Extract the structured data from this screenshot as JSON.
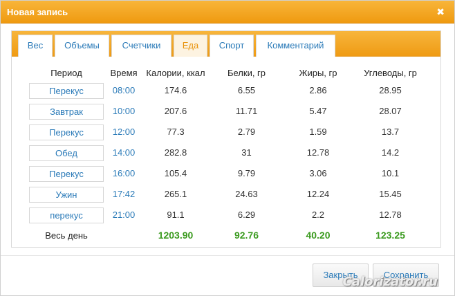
{
  "dialog": {
    "title": "Новая запись",
    "close_glyph": "✖"
  },
  "tabs": [
    {
      "label": "Вес",
      "active": false
    },
    {
      "label": "Объемы",
      "active": false
    },
    {
      "label": "Счетчики",
      "active": false
    },
    {
      "label": "Еда",
      "active": true
    },
    {
      "label": "Спорт",
      "active": false
    },
    {
      "label": "Комментарий",
      "active": false
    }
  ],
  "table": {
    "headers": [
      "Период",
      "Время",
      "Калории, ккал",
      "Белки, гр",
      "Жиры, гр",
      "Углеводы, гр"
    ],
    "rows": [
      {
        "period": "Перекус",
        "time": "08:00",
        "calories": "174.6",
        "protein": "6.55",
        "fat": "2.86",
        "carbs": "28.95"
      },
      {
        "period": "Завтрак",
        "time": "10:00",
        "calories": "207.6",
        "protein": "11.71",
        "fat": "5.47",
        "carbs": "28.07"
      },
      {
        "period": "Перекус",
        "time": "12:00",
        "calories": "77.3",
        "protein": "2.79",
        "fat": "1.59",
        "carbs": "13.7"
      },
      {
        "period": "Обед",
        "time": "14:00",
        "calories": "282.8",
        "protein": "31",
        "fat": "12.78",
        "carbs": "14.2"
      },
      {
        "period": "Перекус",
        "time": "16:00",
        "calories": "105.4",
        "protein": "9.79",
        "fat": "3.06",
        "carbs": "10.1"
      },
      {
        "period": "Ужин",
        "time": "17:42",
        "calories": "265.1",
        "protein": "24.63",
        "fat": "12.24",
        "carbs": "15.45"
      },
      {
        "period": "перекус",
        "time": "21:00",
        "calories": "91.1",
        "protein": "6.29",
        "fat": "2.2",
        "carbs": "12.78"
      }
    ],
    "totals": {
      "label": "Весь день",
      "calories": "1203.90",
      "protein": "92.76",
      "fat": "40.20",
      "carbs": "123.25"
    }
  },
  "footer": {
    "close_label": "Закрыть",
    "save_label": "Сохранить"
  },
  "watermark": "Calorizator.ru",
  "colors": {
    "accent": "#f0a020",
    "link": "#2a7ab8",
    "active_tab": "#e8920a",
    "total_green": "#3a9a1e"
  }
}
